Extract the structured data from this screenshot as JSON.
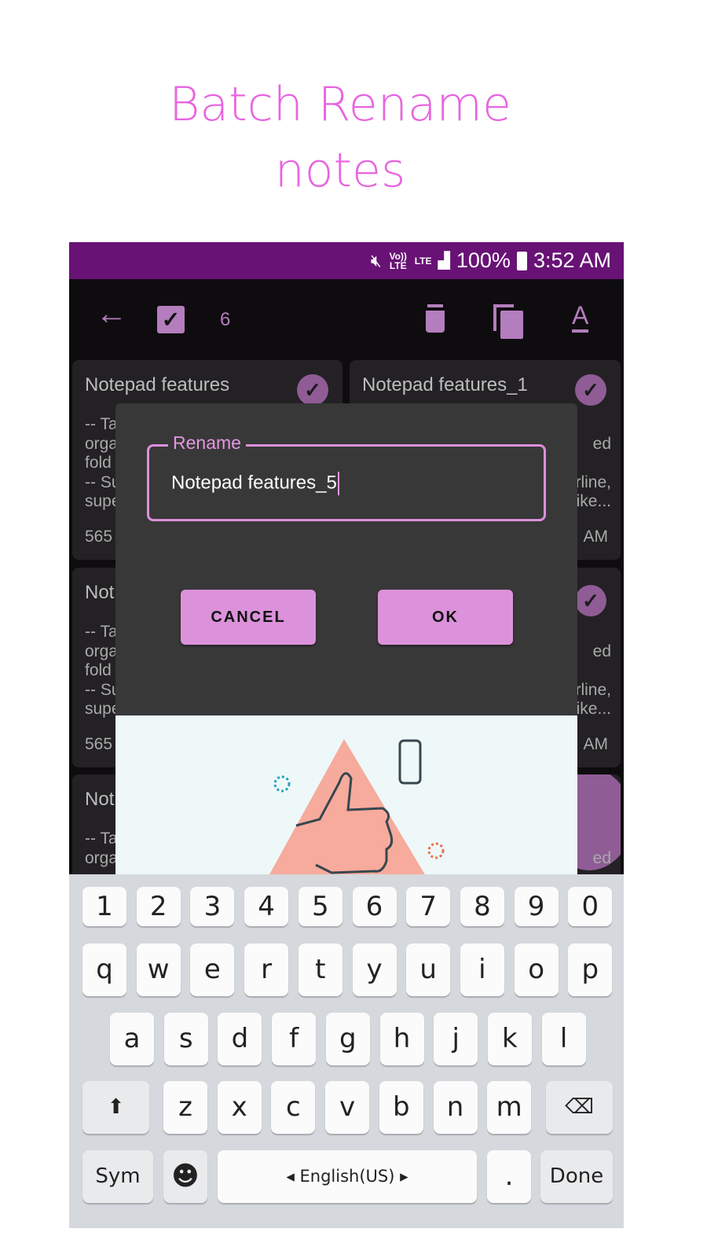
{
  "headline": {
    "line1": "Batch Rename",
    "line2": "notes"
  },
  "status_bar": {
    "mute_icon": "mute-icon",
    "volte": "Vo)) LTE",
    "lte": "LTE",
    "battery": "100%",
    "time": "3:52 AM"
  },
  "toolbar": {
    "selected_count": "6",
    "icons": [
      "back-arrow-icon",
      "select-all-checkbox-icon",
      "delete-icon",
      "copy-icon",
      "rename-text-icon"
    ]
  },
  "cards": [
    {
      "title": "Notepad features",
      "lines": [
        "-- Ta",
        "orga",
        "fold",
        "-- Su",
        "supe"
      ],
      "footer": "565"
    },
    {
      "title": "Notepad features_1",
      "lines": [
        "ed",
        "rline,",
        "ike..."
      ],
      "footer": "AM"
    },
    {
      "title": "Not",
      "lines": [
        "-- Ta",
        "orga",
        "fold",
        "-- Su",
        "supe"
      ],
      "footer": "565"
    },
    {
      "title": "",
      "lines": [
        "ed",
        "rline,",
        "ike..."
      ],
      "footer": "AM"
    },
    {
      "title": "Not",
      "lines": [
        "-- Ta",
        "orga"
      ],
      "footer": ""
    },
    {
      "title": "",
      "lines": [
        "ed"
      ],
      "footer": ""
    }
  ],
  "dialog": {
    "label": "Rename",
    "value": "Notepad features_5",
    "cancel": "CANCEL",
    "ok": "OK"
  },
  "keyboard": {
    "numbers": [
      "1",
      "2",
      "3",
      "4",
      "5",
      "6",
      "7",
      "8",
      "9",
      "0"
    ],
    "row1": [
      "q",
      "w",
      "e",
      "r",
      "t",
      "y",
      "u",
      "i",
      "o",
      "p"
    ],
    "row2": [
      "a",
      "s",
      "d",
      "f",
      "g",
      "h",
      "j",
      "k",
      "l"
    ],
    "row3": [
      "z",
      "x",
      "c",
      "v",
      "b",
      "n",
      "m"
    ],
    "sym": "Sym",
    "space": "English(US)",
    "period": ".",
    "done": "Done"
  },
  "colors": {
    "accent": "#dc92db",
    "status_bar": "#681275",
    "headline": "#e865e0"
  }
}
